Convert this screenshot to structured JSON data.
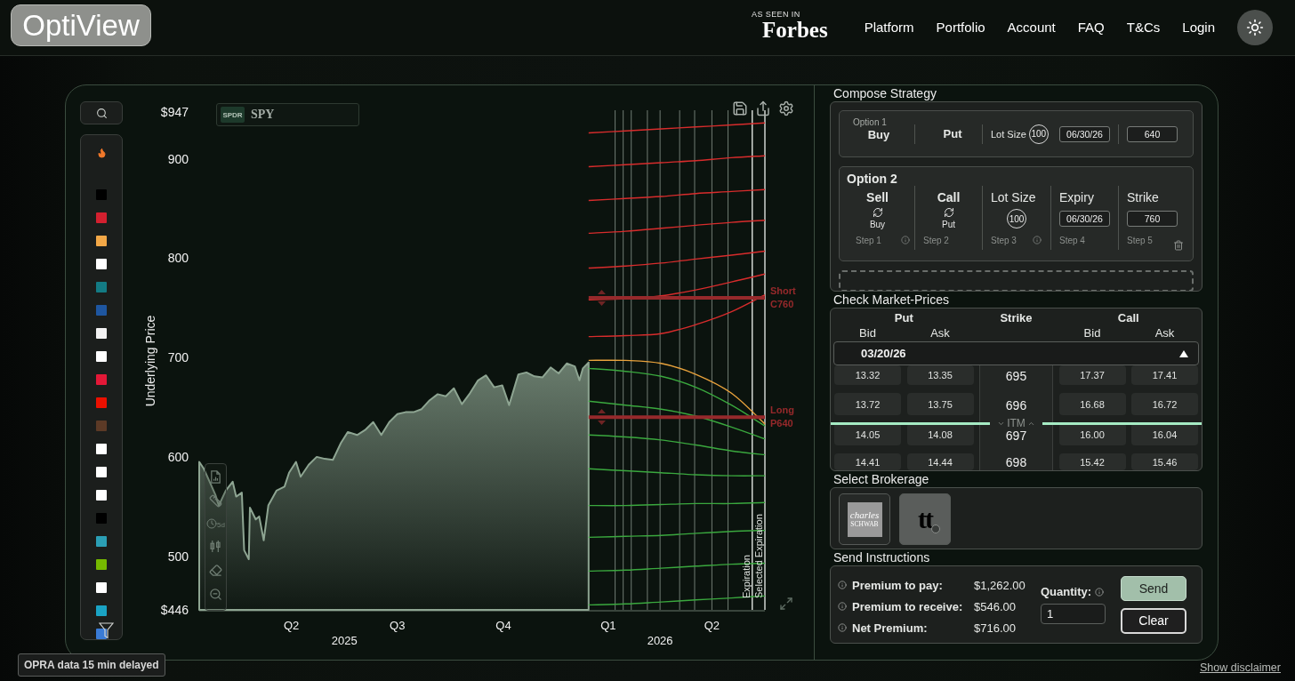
{
  "header": {
    "logo": "OptiView",
    "press": {
      "caption": "AS SEEN IN",
      "name": "Forbes"
    },
    "nav": [
      "Platform",
      "Portfolio",
      "Account",
      "FAQ",
      "T&Cs",
      "Login"
    ]
  },
  "sidebar": {
    "tickers": [
      {
        "color": "#000000"
      },
      {
        "color": "#d3202f"
      },
      {
        "color": "#f3a847"
      },
      {
        "color": "#ffffff"
      },
      {
        "color": "#137b84"
      },
      {
        "color": "#1e56a0"
      },
      {
        "color": "#f2f2f2"
      },
      {
        "color": "#ffffff"
      },
      {
        "color": "#e31837"
      },
      {
        "color": "#eb1000"
      },
      {
        "color": "#5c3a26"
      },
      {
        "color": "#ffffff"
      },
      {
        "color": "#ffffff"
      },
      {
        "color": "#ffffff"
      },
      {
        "color": "#000000"
      },
      {
        "color": "#2b9fb5"
      },
      {
        "color": "#76b900"
      },
      {
        "color": "#ffffff"
      },
      {
        "color": "#1aa3c4"
      },
      {
        "color": "#3a7bd5"
      }
    ]
  },
  "chart": {
    "symbol": "SPY",
    "symbol_logo": "SPDR",
    "drawing_tools": [
      {
        "kind": "report"
      },
      {
        "kind": "ruler"
      },
      {
        "kind": "period",
        "label": "5d"
      },
      {
        "kind": "indicators"
      },
      {
        "kind": "eraser"
      },
      {
        "kind": "zoom"
      }
    ],
    "chart_data": [
      {
        "type": "line",
        "ylabel": "Underlying Price",
        "xlim": [
          "2025-02-24",
          "2026-06-30"
        ],
        "ylim": [
          446,
          947
        ],
        "yticks": [
          {
            "value": 947,
            "label": "$947"
          },
          900,
          800,
          700,
          600,
          500,
          {
            "value": 446,
            "label": "$446"
          }
        ],
        "xticks": [
          {
            "value": "2025-05-15",
            "label": "Q2"
          },
          {
            "value": "2025-08-15",
            "label": "Q3"
          },
          {
            "value": "2025-11-15",
            "label": "Q4"
          },
          {
            "value": "2026-02-14",
            "label": "Q1"
          },
          {
            "value": "2026-05-15",
            "label": "Q2"
          }
        ],
        "annotations": [
          "2025",
          "2026"
        ],
        "x": [
          "2026-01-28",
          "2026-03-01",
          "2026-04-01",
          "2026-05-01",
          "2026-06-01",
          "2026-06-30"
        ],
        "series": [
          {
            "type": "area",
            "color": "#8ea592",
            "x": [
              "2025-02-24",
              "2025-02-28",
              "2025-03-05",
              "2025-03-10",
              "2025-03-13",
              "2025-03-19",
              "2025-03-25",
              "2025-03-28",
              "2025-04-02",
              "2025-04-04",
              "2025-04-08",
              "2025-04-09",
              "2025-04-14",
              "2025-04-17",
              "2025-04-21",
              "2025-04-25",
              "2025-05-02",
              "2025-05-09",
              "2025-05-13",
              "2025-05-19",
              "2025-05-23",
              "2025-05-30",
              "2025-06-06",
              "2025-06-13",
              "2025-06-20",
              "2025-06-27",
              "2025-07-03",
              "2025-07-11",
              "2025-07-18",
              "2025-07-25",
              "2025-08-01",
              "2025-08-08",
              "2025-08-15",
              "2025-08-22",
              "2025-08-29",
              "2025-09-05",
              "2025-09-12",
              "2025-09-19",
              "2025-09-26",
              "2025-10-03",
              "2025-10-10",
              "2025-10-17",
              "2025-10-24",
              "2025-10-31",
              "2025-11-07",
              "2025-11-14",
              "2025-11-20",
              "2025-11-28",
              "2025-12-05",
              "2025-12-12",
              "2025-12-19",
              "2025-12-26",
              "2026-01-02",
              "2026-01-09",
              "2026-01-16",
              "2026-01-20",
              "2026-01-23",
              "2026-01-28"
            ],
            "values": [
              595,
              588,
              575,
              562,
              551,
              566,
              575,
              560,
              564,
              506,
              497,
              549,
              537,
              540,
              516,
              551,
              566,
              570,
              584,
              595,
              580,
              592,
              600,
              598,
              597,
              614,
              625,
              622,
              627,
              635,
              622,
              635,
              643,
              645,
              645,
              648,
              657,
              663,
              661,
              669,
              653,
              664,
              677,
              682,
              670,
              672,
              652,
              683,
              685,
              681,
              680,
              690,
              684,
              694,
              691,
              677,
              689,
              695
            ]
          },
          {
            "color": "#d82c2c",
            "values": [
              926,
              928,
              930,
              932,
              934,
              936
            ]
          },
          {
            "color": "#d82c2c",
            "values": [
              892,
              894,
              896,
              898,
              901,
              903
            ]
          },
          {
            "color": "#d82c2c",
            "values": [
              858,
              860,
              862,
              865,
              867,
              869
            ]
          },
          {
            "color": "#d82c2c",
            "values": [
              825,
              827,
              830,
              833,
              836,
              838
            ]
          },
          {
            "color": "#d82c2c",
            "values": [
              790,
              792,
              795,
              799,
              803,
              807
            ]
          },
          {
            "color": "#d82c2c",
            "values": [
              758,
              759,
              762,
              768,
              776,
              784
            ]
          },
          {
            "color": "#d82c2c",
            "values": [
              721,
              722,
              724,
              733,
              746,
              763
            ]
          },
          {
            "color": "#3aa83e",
            "values": [
              689,
              686,
              681,
              670,
              652,
              631
            ]
          },
          {
            "color": "#3aa83e",
            "values": [
              656,
              652,
              648,
              641,
              630,
              618
            ]
          },
          {
            "color": "#3aa83e",
            "values": [
              622,
              620,
              617,
              612,
              606,
              602
            ]
          },
          {
            "color": "#3aa83e",
            "values": [
              588,
              586,
              584,
              582,
              581,
              581
            ]
          },
          {
            "color": "#3aa83e",
            "values": [
              551,
              551,
              552,
              553,
              553,
              554
            ]
          },
          {
            "color": "#3aa83e",
            "values": [
              519,
              520,
              521,
              523,
              525,
              526
            ]
          },
          {
            "color": "#3aa83e",
            "values": [
              485,
              486,
              488,
              490,
              492,
              493
            ]
          },
          {
            "color": "#3aa83e",
            "values": [
              451,
              452,
              454,
              456,
              458,
              460
            ]
          },
          {
            "color": "#e8a23c",
            "values": [
              697,
              697,
              694,
              683,
              664,
              633
            ]
          }
        ],
        "ref_lines": [
          {
            "axis": "y",
            "value": 760,
            "label": "Short C760",
            "color": "#96292b"
          },
          {
            "axis": "y",
            "value": 640,
            "label": "Long P640",
            "color": "#96292b"
          },
          {
            "axis": "x",
            "value": "2026-02-20",
            "color": "#707c73"
          },
          {
            "axis": "x",
            "value": "2026-02-27",
            "color": "#707c73"
          },
          {
            "axis": "x",
            "value": "2026-03-06",
            "color": "#707c73"
          },
          {
            "axis": "x",
            "value": "2026-03-20",
            "color": "#707c73"
          },
          {
            "axis": "x",
            "value": "2026-03-31",
            "color": "#707c73"
          },
          {
            "axis": "x",
            "value": "2026-04-17",
            "color": "#707c73"
          },
          {
            "axis": "x",
            "value": "2026-04-30",
            "color": "#707c73"
          },
          {
            "axis": "x",
            "value": "2026-05-15",
            "color": "#707c73"
          },
          {
            "axis": "x",
            "value": "2026-05-29",
            "color": "#707c73"
          },
          {
            "axis": "x",
            "value": "2026-06-19",
            "label": "Expiration",
            "color": "#dfe3df"
          },
          {
            "axis": "x",
            "value": "2026-06-30",
            "label": "Selected Expiration",
            "color": "#dfe3df"
          }
        ]
      }
    ]
  },
  "compose_strategy": {
    "title": "Compose Strategy",
    "legs": [
      {
        "kind": "summary",
        "title": "Option 1",
        "action": "Buy",
        "type": "Put",
        "lot_label": "Lot Size",
        "lot_size": "100",
        "expiry": "06/30/26",
        "strike": "640",
        "removable": false
      },
      {
        "kind": "detail",
        "title": "Option 2",
        "removable": true,
        "steps": [
          {
            "kind": "toggle",
            "heading": "Sell",
            "alternative": "Buy",
            "step": "Step 1",
            "info": true
          },
          {
            "kind": "toggle",
            "heading": "Call",
            "alternative": "Put",
            "step": "Step 2",
            "info": false
          },
          {
            "kind": "lot",
            "heading": "Lot Size",
            "value": "100",
            "step": "Step 3",
            "info": true
          },
          {
            "kind": "field",
            "heading": "Expiry",
            "value": "06/30/26",
            "step": "Step 4",
            "info": false
          },
          {
            "kind": "field",
            "heading": "Strike",
            "value": "760",
            "step": "Step 5",
            "info": false
          }
        ]
      }
    ]
  },
  "market_prices": {
    "title": "Check Market-Prices",
    "columns": [
      {
        "group": "Put",
        "sub": [
          "Bid",
          "Ask"
        ]
      },
      {
        "group": "Strike"
      },
      {
        "group": "Call",
        "sub": [
          "Bid",
          "Ask"
        ]
      }
    ],
    "expiry": "03/20/26",
    "rows": [
      {
        "kind": "quote",
        "put_bid": "13.32",
        "put_ask": "13.35",
        "strike": "695",
        "call_bid": "17.37",
        "call_ask": "17.41"
      },
      {
        "kind": "quote",
        "put_bid": "13.72",
        "put_ask": "13.75",
        "strike": "696",
        "call_bid": "16.68",
        "call_ask": "16.72"
      },
      {
        "kind": "marker",
        "label": "ITM"
      },
      {
        "kind": "quote",
        "put_bid": "14.05",
        "put_ask": "14.08",
        "strike": "697",
        "call_bid": "16.00",
        "call_ask": "16.04"
      },
      {
        "kind": "quote",
        "put_bid": "14.41",
        "put_ask": "14.44",
        "strike": "698",
        "call_bid": "15.42",
        "call_ask": "15.46"
      }
    ]
  },
  "brokerage": {
    "title": "Select Brokerage",
    "options": [
      {
        "kind": "boxed",
        "lines": [
          "charles",
          "SCHWAB"
        ],
        "selected": false
      },
      {
        "kind": "monogram",
        "lines": [
          "tt"
        ],
        "selected": false
      }
    ]
  },
  "send_instructions": {
    "title": "Send Instructions",
    "totals": [
      {
        "label": "Premium to pay:",
        "value": "$1,262.00"
      },
      {
        "label": "Premium to receive:",
        "value": "$546.00"
      },
      {
        "label": "Net Premium:",
        "value": "$716.00"
      }
    ],
    "quantity": {
      "label": "Quantity:",
      "value": "1"
    },
    "buttons": [
      {
        "kind": "primary",
        "label": "Send"
      },
      {
        "kind": "secondary",
        "label": "Clear"
      }
    ]
  },
  "footer": {
    "notice": "OPRA data 15 min delayed",
    "disclaimer": "Show disclaimer"
  }
}
